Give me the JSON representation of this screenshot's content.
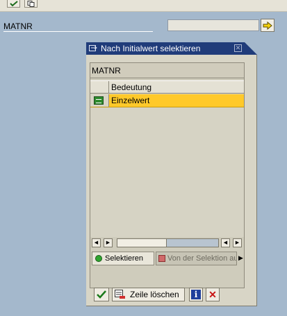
{
  "field": {
    "label": "MATNR",
    "value": ""
  },
  "dialog": {
    "title": "Nach Initialwert selektieren",
    "panel_caption": "MATNR",
    "table": {
      "column_header": "Bedeutung",
      "rows": [
        {
          "label": "Einzelwert",
          "selected": true
        }
      ]
    },
    "tabs": [
      {
        "label": "Selektieren",
        "active": true
      },
      {
        "label": "Von der Selektion au",
        "active": false
      }
    ],
    "footer": {
      "delete_row_label": "Zeile löschen"
    }
  },
  "colors": {
    "desktop": "#a4b8cc",
    "title_bar": "#203c7a",
    "selected_row": "#ffc92a",
    "dialog": "#d8d5c6"
  },
  "icons": {
    "toolbar": [
      "check-icon",
      "copy-icon"
    ],
    "go": "arrow-right-icon",
    "title": "dialog-icon",
    "row": "single-value-icon",
    "tab_active": "green-dot-icon",
    "tab_inactive": "red-square-icon",
    "footer": [
      "check-icon",
      "delete-row-icon",
      "info-icon",
      "cancel-icon"
    ]
  }
}
